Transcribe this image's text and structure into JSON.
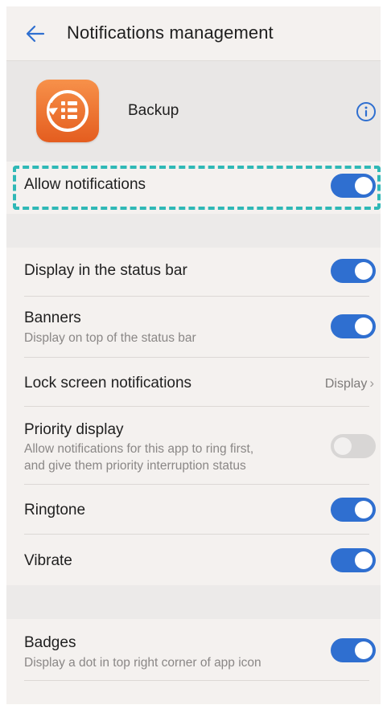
{
  "header": {
    "title": "Notifications management"
  },
  "app": {
    "name": "Backup"
  },
  "allow": {
    "label": "Allow notifications",
    "enabled": true
  },
  "settings": [
    {
      "label": "Display in the status bar",
      "sub": "",
      "enabled": true
    },
    {
      "label": "Banners",
      "sub": "Display on top of the status bar",
      "enabled": true
    },
    {
      "label": "Lock screen notifications",
      "value": "Display"
    },
    {
      "label": "Priority display",
      "sub1": "Allow notifications for this app to ring first,",
      "sub2": "and give them priority interruption status",
      "enabled": false
    },
    {
      "label": "Ringtone",
      "enabled": true
    },
    {
      "label": "Vibrate",
      "enabled": true
    }
  ],
  "badges": {
    "label": "Badges",
    "sub": "Display a dot in top right corner of app icon",
    "enabled": true
  },
  "colors": {
    "toggle_on": "#2f6fd0",
    "toggle_off": "#d8d6d5",
    "highlight_dash": "#2fb8b6",
    "app_icon": "#f07a35",
    "back_arrow": "#2f6fd0"
  },
  "icons": {
    "back": "arrow-left-icon",
    "info": "info-icon",
    "app": "backup-app-icon",
    "chevron": "chevron-right-icon"
  }
}
